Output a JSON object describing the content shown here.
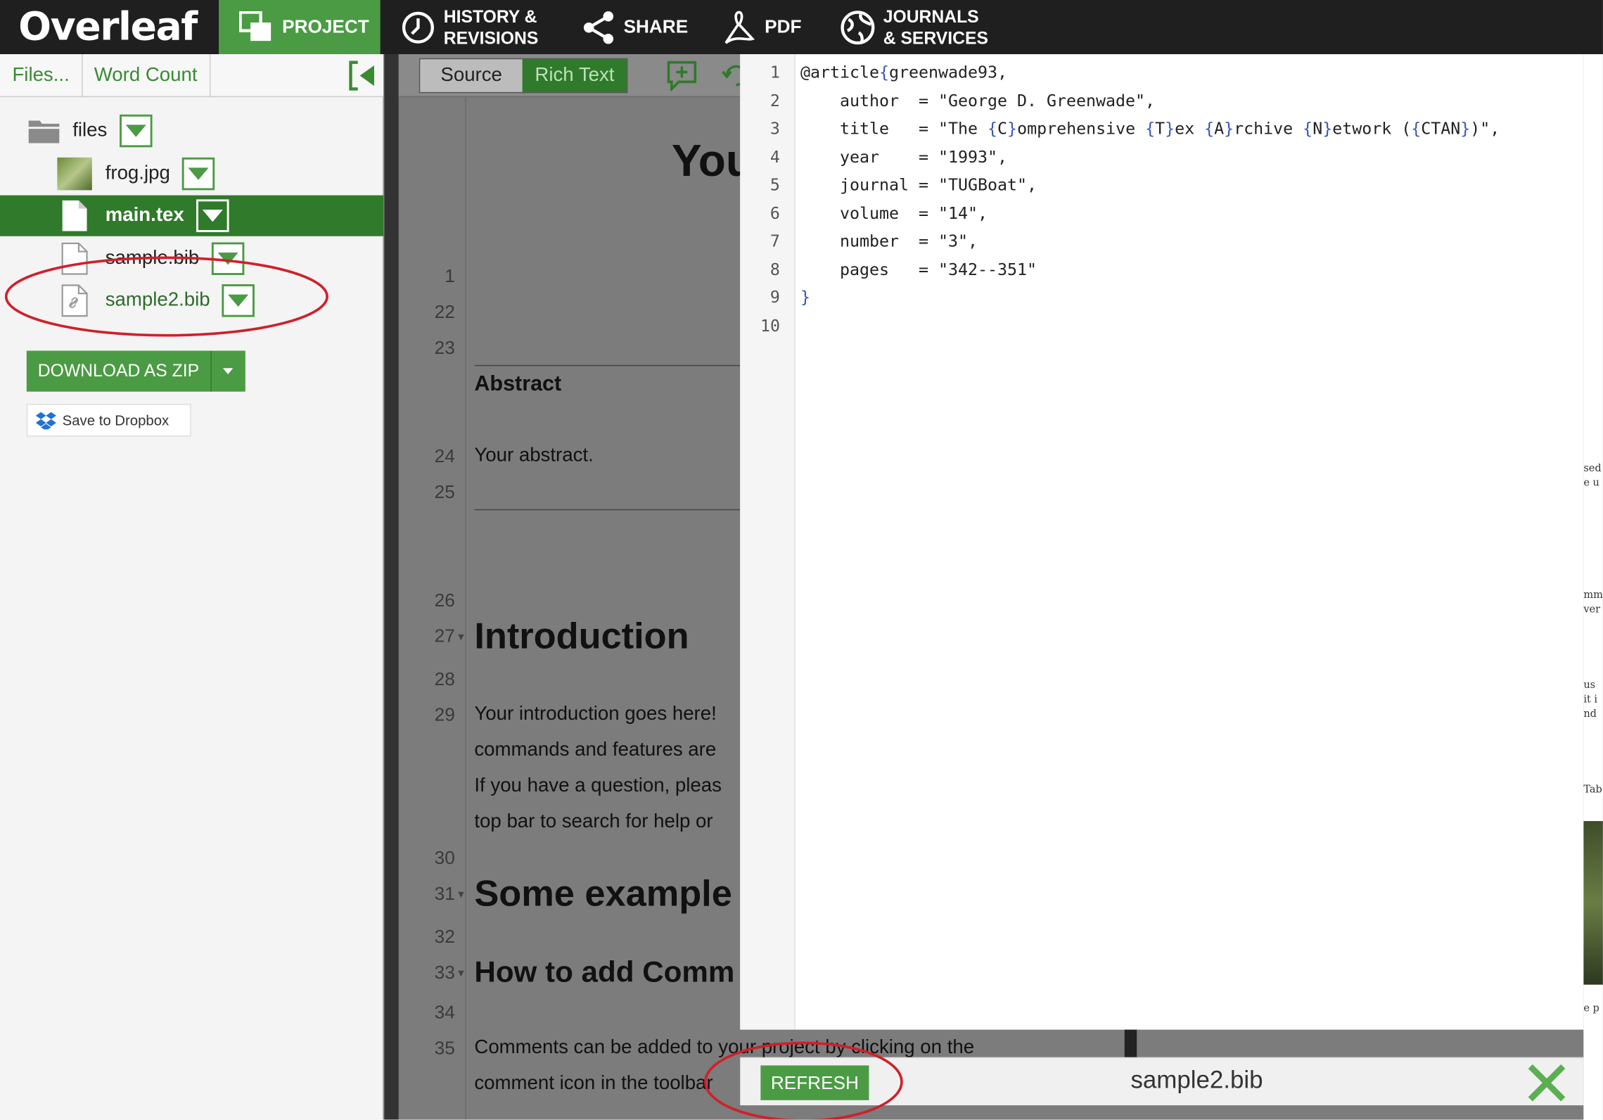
{
  "topbar": {
    "logo": "Overleaf",
    "nav": {
      "project": "PROJECT",
      "history_1": "HISTORY &",
      "history_2": "REVISIONS",
      "share": "SHARE",
      "pdf": "PDF",
      "journals_1": "JOURNALS",
      "journals_2": "& SERVICES"
    }
  },
  "sidebar": {
    "tabs": {
      "files": "Files...",
      "word_count": "Word Count"
    },
    "tree": {
      "folder": "files",
      "items": [
        "frog.jpg",
        "main.tex",
        "sample.bib",
        "sample2.bib"
      ]
    },
    "download_label": "DOWNLOAD AS ZIP",
    "dropbox_label": "Save to Dropbox"
  },
  "editor": {
    "source_label": "Source",
    "rich_label": "Rich Text",
    "line_numbers": [
      "1",
      "22",
      "23",
      "24",
      "25",
      "26",
      "27",
      "28",
      "29",
      "30",
      "31",
      "32",
      "33",
      "34",
      "35"
    ],
    "title_fragment": "You",
    "abstract_heading": "Abstract",
    "abstract_text": "Your abstract.",
    "intro_heading": "Introduction",
    "intro_lines": [
      "Your introduction goes here!",
      "commands and features are",
      "If you have a question, pleas",
      "top bar to search for help or"
    ],
    "examples_heading": "Some example",
    "comments_heading": "How to add Comm",
    "comments_lines": [
      "Comments can be added to your project by clicking on the",
      "comment icon in the toolbar"
    ]
  },
  "preview": {
    "line_numbers": [
      "1",
      "2",
      "3",
      "4",
      "5",
      "6",
      "7",
      "8",
      "9",
      "10"
    ],
    "filename": "sample2.bib",
    "refresh_label": "REFRESH"
  },
  "colors": {
    "brand_green": "#4b9b44",
    "dark_green": "#2f7a2b",
    "annotation_red": "#d0202a"
  }
}
